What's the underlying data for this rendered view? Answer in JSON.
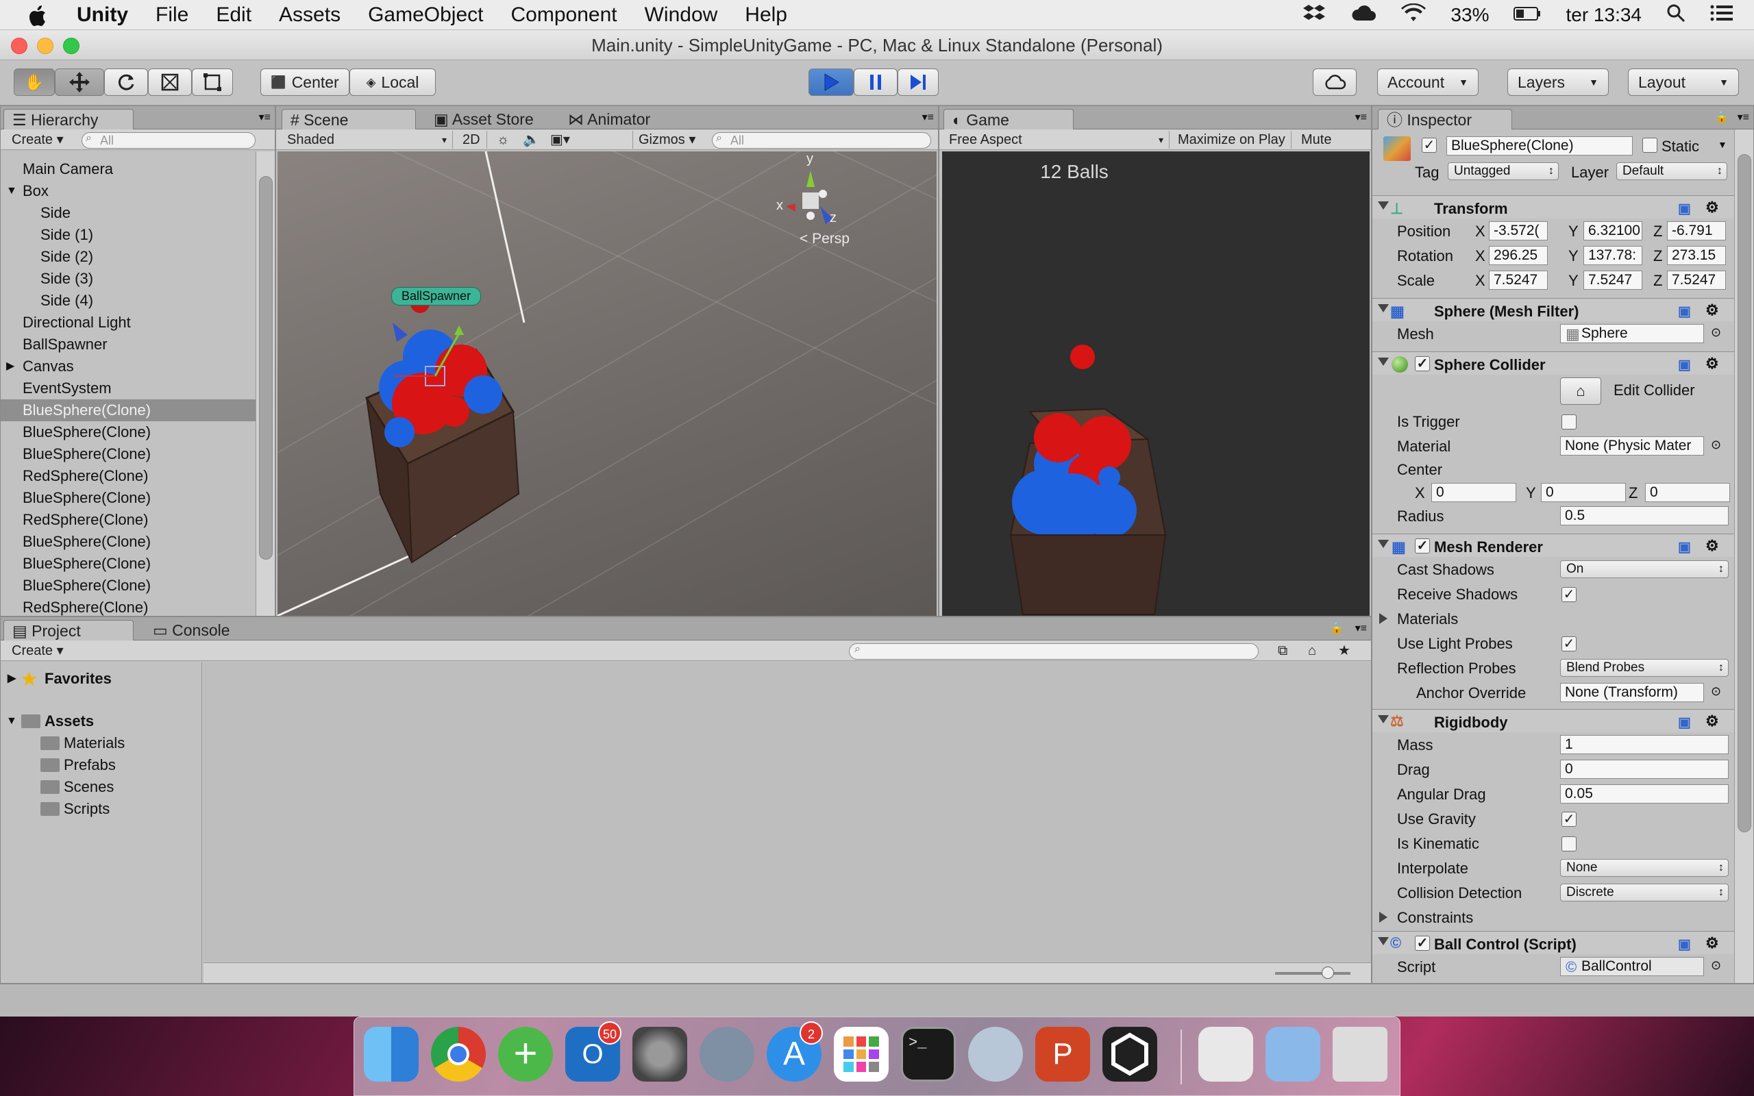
{
  "menubar": {
    "app_name": "Unity",
    "items": [
      "File",
      "Edit",
      "Assets",
      "GameObject",
      "Component",
      "Window",
      "Help"
    ],
    "battery": "33%",
    "clock": "ter 13:34"
  },
  "window": {
    "title": "Main.unity - SimpleUnityGame - PC, Mac & Linux Standalone (Personal)"
  },
  "toolbar": {
    "pivot": "Center",
    "space": "Local",
    "account": "Account",
    "layers": "Layers",
    "layout": "Layout"
  },
  "hierarchy": {
    "tab": "Hierarchy",
    "create": "Create",
    "search_placeholder": "All",
    "items": [
      "Main Camera",
      "Box",
      "Side",
      "Side (1)",
      "Side (2)",
      "Side (3)",
      "Side (4)",
      "Directional Light",
      "BallSpawner",
      "Canvas",
      "EventSystem",
      "BlueSphere(Clone)",
      "BlueSphere(Clone)",
      "BlueSphere(Clone)",
      "RedSphere(Clone)",
      "BlueSphere(Clone)",
      "RedSphere(Clone)",
      "BlueSphere(Clone)",
      "BlueSphere(Clone)",
      "BlueSphere(Clone)",
      "RedSphere(Clone)"
    ]
  },
  "scene": {
    "tabs": [
      "Scene",
      "Asset Store",
      "Animator"
    ],
    "shading": "Shaded",
    "mode_2d": "2D",
    "gizmos": "Gizmos",
    "search_placeholder": "All",
    "object_label": "BallSpawner",
    "persp": "Persp",
    "axis_x": "x",
    "axis_y": "y",
    "axis_z": "z"
  },
  "game": {
    "tab": "Game",
    "aspect": "Free Aspect",
    "maximize": "Maximize on Play",
    "mute": "Mute audio",
    "balls_text": "12 Balls"
  },
  "project": {
    "tabs": [
      "Project",
      "Console"
    ],
    "create": "Create",
    "favorites": "Favorites",
    "assets": "Assets",
    "folders": [
      "Materials",
      "Prefabs",
      "Scenes",
      "Scripts"
    ]
  },
  "inspector": {
    "tab": "Inspector",
    "object_name": "BlueSphere(Clone)",
    "static": "Static",
    "tag_label": "Tag",
    "tag": "Untagged",
    "layer_label": "Layer",
    "layer": "Default",
    "transform": {
      "title": "Transform",
      "position_label": "Position",
      "position": [
        "-3.572(",
        "6.32100",
        "-6.791"
      ],
      "rotation_label": "Rotation",
      "rotation": [
        "296.25",
        "137.78:",
        "273.15"
      ],
      "scale_label": "Scale",
      "scale": [
        "7.5247",
        "7.5247",
        "7.5247"
      ],
      "x": "X",
      "y": "Y",
      "z": "Z"
    },
    "mesh_filter": {
      "title": "Sphere (Mesh Filter)",
      "mesh_label": "Mesh",
      "mesh": "Sphere"
    },
    "sphere_collider": {
      "title": "Sphere Collider",
      "edit_collider": "Edit Collider",
      "is_trigger": "Is Trigger",
      "material_label": "Material",
      "material": "None (Physic Mater",
      "center_label": "Center",
      "center": [
        "0",
        "0",
        "0"
      ],
      "radius_label": "Radius",
      "radius": "0.5"
    },
    "mesh_renderer": {
      "title": "Mesh Renderer",
      "cast_shadows_label": "Cast Shadows",
      "cast_shadows": "On",
      "receive_shadows": "Receive Shadows",
      "materials": "Materials",
      "use_light_probes": "Use Light Probes",
      "reflection_probes_label": "Reflection Probes",
      "reflection_probes": "Blend Probes",
      "anchor_override_label": "Anchor Override",
      "anchor_override": "None (Transform)"
    },
    "rigidbody": {
      "title": "Rigidbody",
      "mass_label": "Mass",
      "mass": "1",
      "drag_label": "Drag",
      "drag": "0",
      "angular_drag_label": "Angular Drag",
      "angular_drag": "0.05",
      "use_gravity": "Use Gravity",
      "is_kinematic": "Is Kinematic",
      "interpolate_label": "Interpolate",
      "interpolate": "None",
      "collision_label": "Collision Detection",
      "collision": "Discrete",
      "constraints": "Constraints"
    },
    "ball_control": {
      "title": "Ball Control (Script)",
      "script_label": "Script",
      "script": "BallControl"
    }
  },
  "dock": {
    "mail_badge": "50",
    "appstore_badge": "2"
  },
  "colors": {
    "play_blue": "#3f74c2",
    "ball_red": "#d81414",
    "ball_blue": "#1f62e0"
  }
}
